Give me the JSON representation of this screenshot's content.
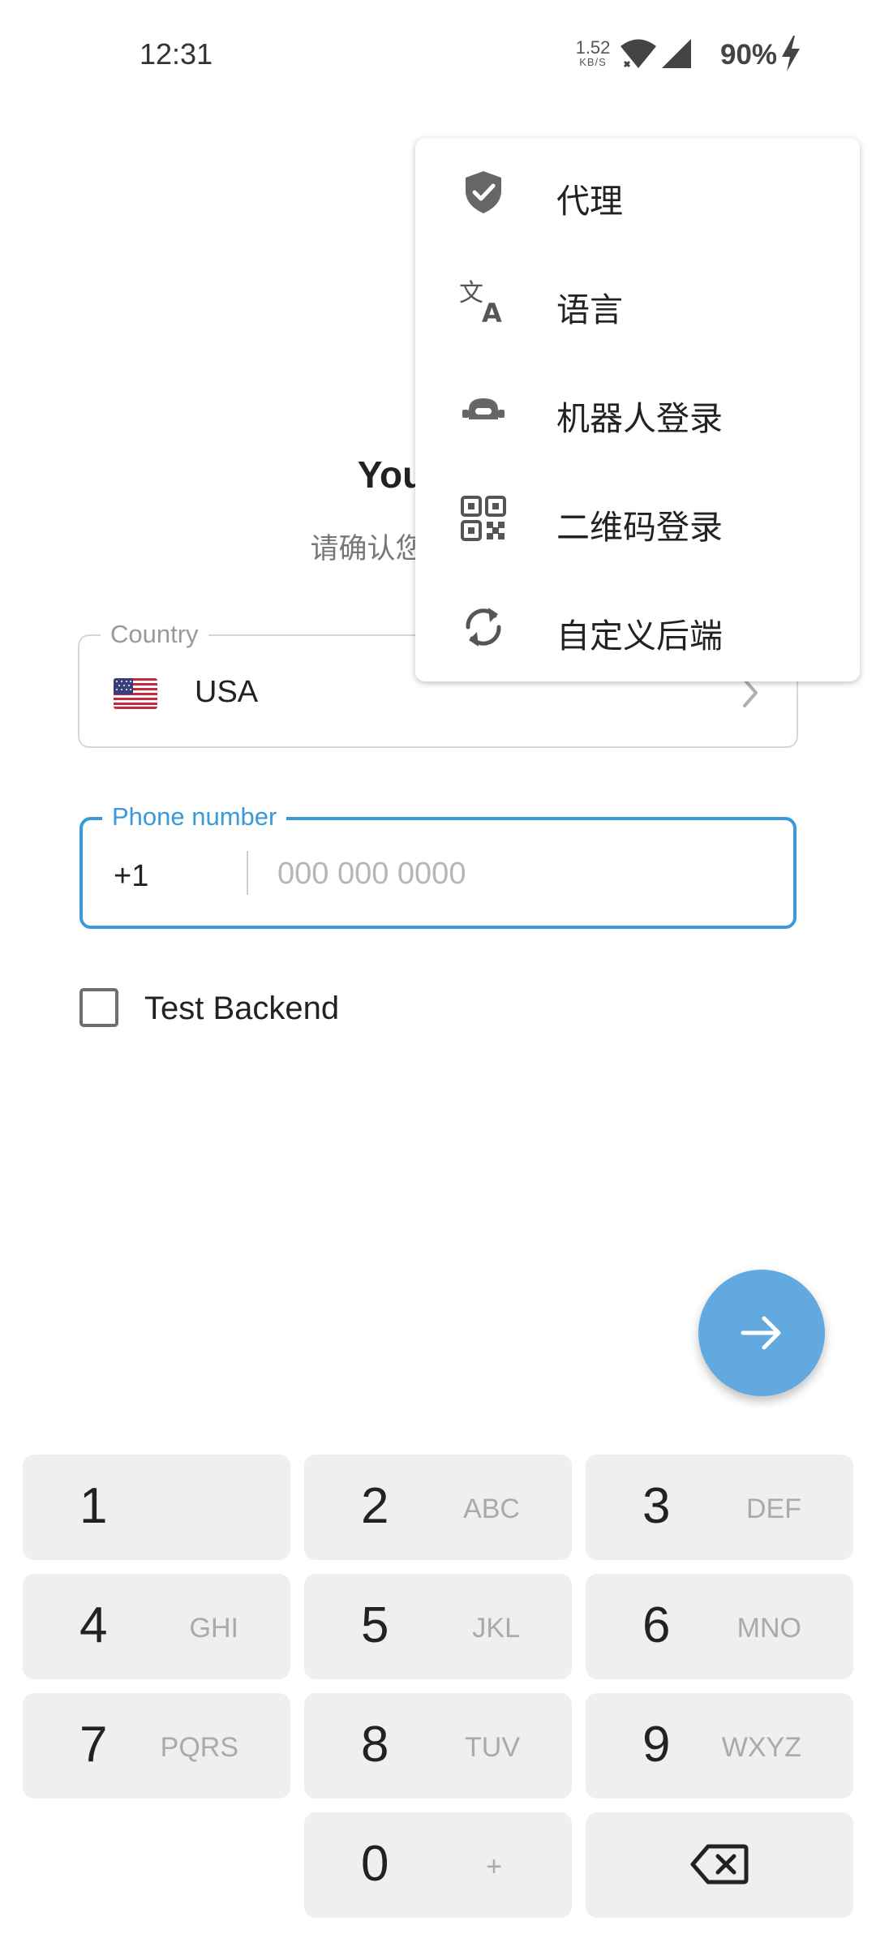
{
  "status_bar": {
    "time": "12:31",
    "net_speed": "1.52",
    "net_speed_unit": "KB/S",
    "battery": "90%"
  },
  "page": {
    "title": "Your pho",
    "subtitle": "请确认您的国家代码"
  },
  "country_field": {
    "legend": "Country",
    "value": "USA"
  },
  "phone_field": {
    "legend": "Phone number",
    "code": "+1",
    "value": "",
    "placeholder": "000 000 0000"
  },
  "checkbox": {
    "label": "Test Backend",
    "checked": false
  },
  "menu": {
    "items": [
      {
        "label": "代理",
        "icon": "shield-check-icon"
      },
      {
        "label": "语言",
        "icon": "translate-icon"
      },
      {
        "label": "机器人登录",
        "icon": "bot-icon"
      },
      {
        "label": "二维码登录",
        "icon": "qr-code-icon"
      },
      {
        "label": "自定义后端",
        "icon": "sync-icon"
      }
    ]
  },
  "keypad": {
    "keys": [
      {
        "digit": "1",
        "letters": ""
      },
      {
        "digit": "2",
        "letters": "ABC"
      },
      {
        "digit": "3",
        "letters": "DEF"
      },
      {
        "digit": "4",
        "letters": "GHI"
      },
      {
        "digit": "5",
        "letters": "JKL"
      },
      {
        "digit": "6",
        "letters": "MNO"
      },
      {
        "digit": "7",
        "letters": "PQRS"
      },
      {
        "digit": "8",
        "letters": "TUV"
      },
      {
        "digit": "9",
        "letters": "WXYZ"
      },
      {
        "digit": "0",
        "letters": "+"
      }
    ]
  },
  "colors": {
    "accent": "#3a9ad9",
    "fab": "#62a9e0",
    "key_background": "#efefef"
  }
}
